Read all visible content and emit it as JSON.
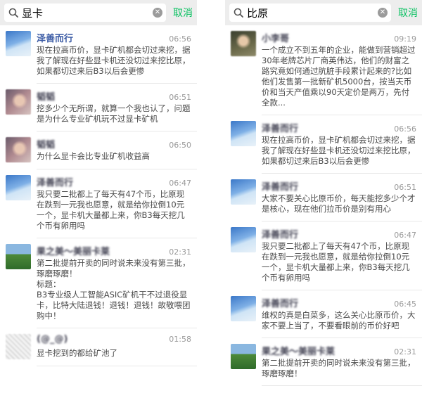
{
  "left": {
    "search": {
      "query": "显卡",
      "cancel_label": "取消"
    },
    "results": [
      {
        "name": "泽善而行",
        "time": "06:56",
        "text": "现在拉高币价，显卡矿机都会切过来挖，据我了解现在好些显卡机还没切过来挖比原，如果都切过来后B3以后会更惨",
        "avatar": "sky",
        "blurred": false
      },
      {
        "name": "韬韬",
        "time": "06:51",
        "text": "挖多少个无所谓，就算一个我也认了，问题是为什么专业矿机玩不过显卡矿机",
        "avatar": "person",
        "blurred": true
      },
      {
        "name": "韬韬",
        "time": "06:50",
        "text": "为什么显卡会比专业矿机收益高",
        "avatar": "person",
        "blurred": true
      },
      {
        "name": "泽善而行",
        "time": "06:47",
        "text": "我只要二批都上了每天有47个币，比原现在跌到一元我也愿意，就是给你拉倒10元一个，显卡机大量都上来，你B3每天挖几个币有卵用吗",
        "avatar": "sky",
        "blurred": true
      },
      {
        "name": "果之美～美丽卡莱",
        "time": "02:31",
        "text": "第二批提前开卖的同时说未来没有第三批，琢磨琢磨！\n标题：\nB3专业级人工智能ASIC矿机干不过退役显卡，比特大陆退钱！退钱！退钱！故敬喂团购中！",
        "avatar": "scene",
        "blurred": true
      },
      {
        "name": "(@_@)",
        "time": "01:58",
        "text": "显卡挖到的都给矿池了",
        "avatar": "sketch",
        "blurred": true
      }
    ]
  },
  "right": {
    "search": {
      "query": "比原",
      "cancel_label": "取消"
    },
    "results": [
      {
        "name": "小李哥",
        "time": "09:19",
        "text": "一个成立不到五年的企业，能做到营销超过30年老牌芯片厂商英伟达，他们的财富之路究竟如何通过肮脏手段累计起来的?比如他们发售第一批新矿机5000台，按当天币价和当天产值乘以90天定价是两万，先付全款...",
        "avatar": "dark",
        "blurred": true
      },
      {
        "name": "泽善而行",
        "time": "06:56",
        "text": "现在拉高币价，显卡矿机都会切过来挖，据我了解现在好些显卡机还没切过来挖比原，如果都切过来后B3以后会更惨",
        "avatar": "sky",
        "blurred": true
      },
      {
        "name": "泽善而行",
        "time": "06:51",
        "text": "大家不要关心比原币价，每天能挖多少个才是核心，现在他们拉币价是别有用心",
        "avatar": "sky",
        "blurred": true
      },
      {
        "name": "泽善而行",
        "time": "06:47",
        "text": "我只要二批都上了每天有47个币，比原现在跌到一元我也愿意，就是给你拉倒10元一个，显卡机大量都上来，你B3每天挖几个币有卵用吗",
        "avatar": "sky",
        "blurred": true
      },
      {
        "name": "泽善而行",
        "time": "06:45",
        "text": "维权的真是白菜多，这么关心比原币价，大家不要上当了，不要看眼前的币价好吧",
        "avatar": "sky",
        "blurred": true
      },
      {
        "name": "果之美～美丽卡莱",
        "time": "02:31",
        "text": "第二批提前开卖的同时说未来没有第三批，琢磨琢磨！",
        "avatar": "scene",
        "blurred": true
      }
    ]
  },
  "colors": {
    "accent": "#07c160",
    "name": "#3b5ba5",
    "header_bg": "#ededed"
  },
  "icons": {
    "search": "search-icon",
    "clear": "clear-icon"
  }
}
